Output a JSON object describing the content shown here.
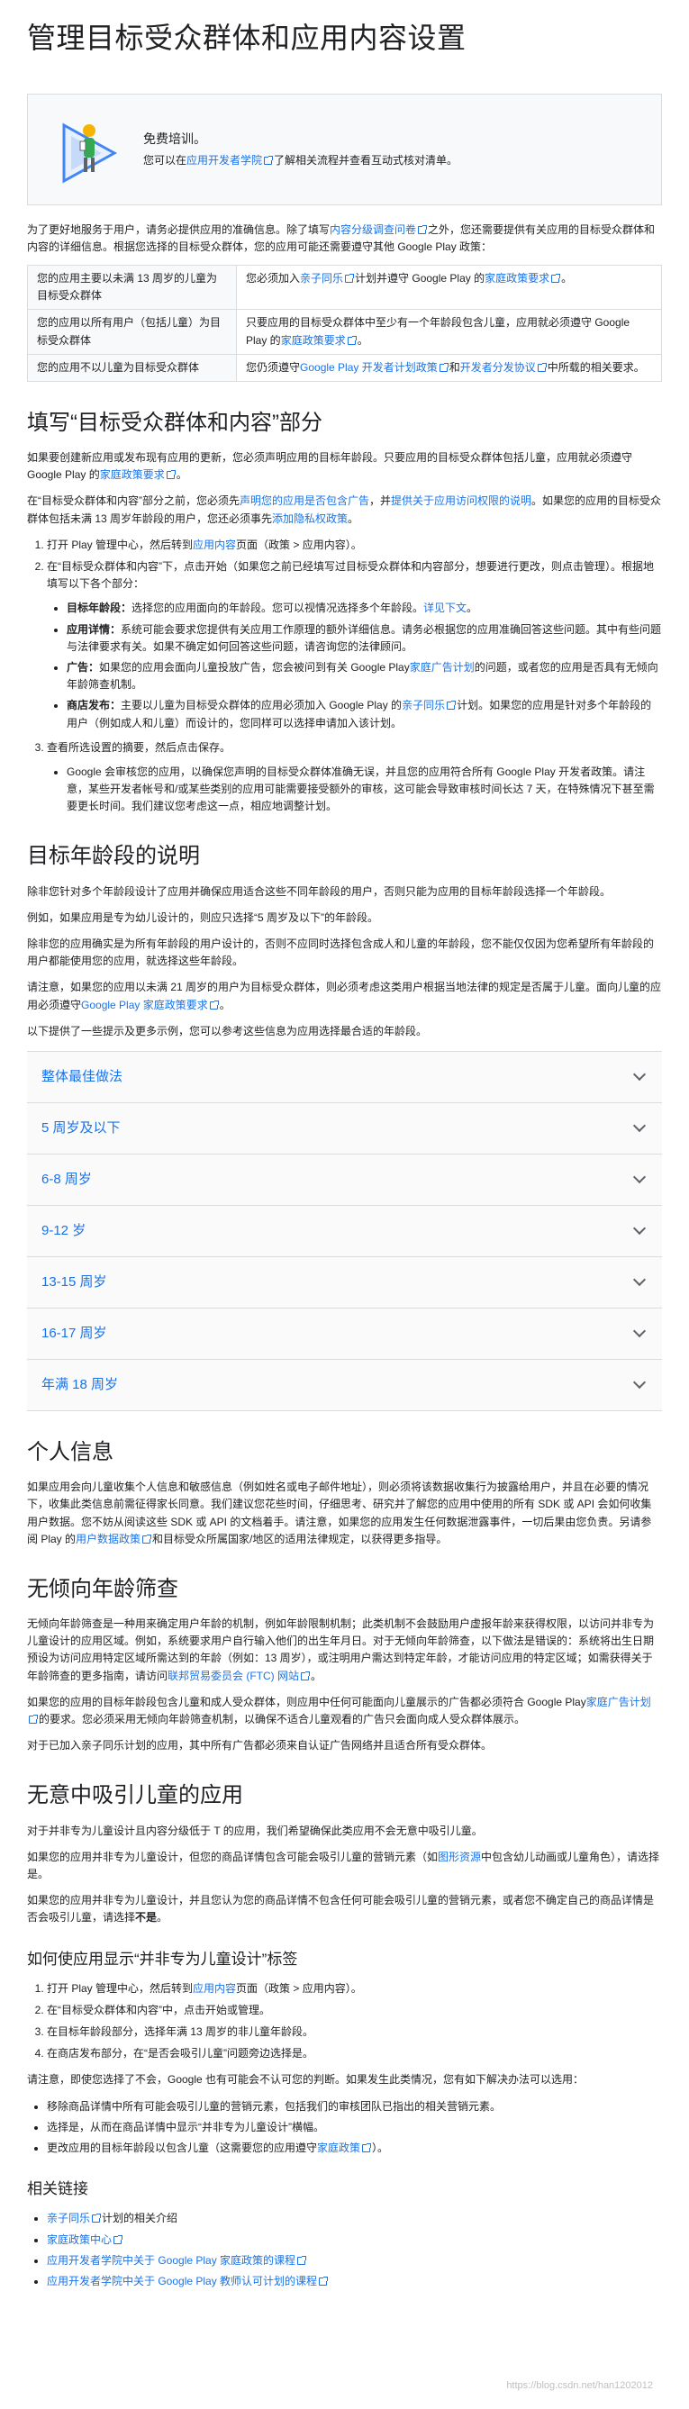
{
  "title": "管理目标受众群体和应用内容设置",
  "training": {
    "title": "免费培训。",
    "text_before": "您可以在",
    "link": "应用开发者学院",
    "text_after": "了解相关流程并查看互动式核对清单。"
  },
  "intro": {
    "text1": "为了更好地服务于用户，请务必提供应用的准确信息。除了填写",
    "link1": "内容分级调查问卷",
    "text2": "之外，您还需要提供有关应用的目标受众群体和内容的详细信息。根据您选择的目标受众群体，您的应用可能还需要遵守其他 Google Play 政策："
  },
  "table": [
    {
      "c1": "您的应用主要以未满 13 周岁的儿童为目标受众群体",
      "c2a": "您必须加入",
      "c2link": "亲子同乐",
      "c2b": "计划并遵守 Google Play 的",
      "c2link2": "家庭政策要求",
      "c2c": "。"
    },
    {
      "c1": "您的应用以所有用户（包括儿童）为目标受众群体",
      "c2a": "只要应用的目标受众群体中至少有一个年龄段包含儿童，应用就必须遵守 Google Play 的",
      "c2link": "家庭政策要求",
      "c2b": "。",
      "c2link2": "",
      "c2c": ""
    },
    {
      "c1": "您的应用不以儿童为目标受众群体",
      "c2a": "您仍须遵守",
      "c2link": "Google Play 开发者计划政策",
      "c2b": "和",
      "c2link2": "开发者分发协议",
      "c2c": "中所载的相关要求。"
    }
  ],
  "section1": {
    "heading": "填写“目标受众群体和内容”部分",
    "p1a": "如果要创建新应用或发布现有应用的更新，您必须声明应用的目标年龄段。只要应用的目标受众群体包括儿童，应用就必须遵守 Google Play 的",
    "p1link": "家庭政策要求",
    "p1b": "。",
    "p2a": "在“目标受众群体和内容”部分之前，您必须先",
    "p2link1": "声明您的应用是否包含广告",
    "p2b": "，并",
    "p2link2": "提供关于应用访问权限的说明",
    "p2c": "。如果您的应用的目标受众群体包括未满 13 周岁年龄段的用户，您还必须事先",
    "p2link3": "添加隐私权政策",
    "p2d": "。",
    "steps": [
      {
        "a": "打开 Play 管理中心，然后转到",
        "link": "应用内容",
        "b": "页面（政策 > 应用内容）。"
      },
      {
        "a": "在“目标受众群体和内容”下，点击开始（如果您之前已经填写过目标受众群体和内容部分，想要进行更改，则点击管理）。根据地填写以下各个部分：",
        "link": "",
        "b": ""
      },
      {
        "a": "查看所选设置的摘要，然后点击保存。",
        "link": "",
        "b": ""
      }
    ],
    "sub_items": [
      {
        "label": "目标年龄段：",
        "a": "选择您的应用面向的年龄段。您可以视情况选择多个年龄段。",
        "link": "详见下文",
        "b": "。"
      },
      {
        "label": "应用详情：",
        "a": "系统可能会要求您提供有关应用工作原理的额外详细信息。请务必根据您的应用准确回答这些问题。其中有些问题与法律要求有关。如果不确定如何回答这些问题，请咨询您的法律顾问。",
        "link": "",
        "b": ""
      },
      {
        "label": "广告：",
        "a": "如果您的应用会面向儿童投放广告，您会被问到有关 Google Play",
        "link": "家庭广告计划",
        "b": "的问题，或者您的应用是否具有无倾向年龄筛查机制。"
      },
      {
        "label": "商店发布：",
        "a": "主要以儿童为目标受众群体的应用必须加入 Google Play 的",
        "link": "亲子同乐",
        "b": "计划。如果您的应用是针对多个年龄段的用户（例如成人和儿童）而设计的，您同样可以选择申请加入该计划。"
      }
    ],
    "step3_note": "Google 会审核您的应用，以确保您声明的目标受众群体准确无误，并且您的应用符合所有 Google Play 开发者政策。请注意，某些开发者帐号和/或某些类别的应用可能需要接受额外的审核，这可能会导致审核时间长达 7 天，在特殊情况下甚至需要更长时间。我们建议您考虑这一点，相应地调整计划。"
  },
  "section2": {
    "heading": "目标年龄段的说明",
    "p1": "除非您针对多个年龄段设计了应用并确保应用适合这些不同年龄段的用户，否则只能为应用的目标年龄段选择一个年龄段。",
    "p2": "例如，如果应用是专为幼儿设计的，则应只选择“5 周岁及以下”的年龄段。",
    "p3": "除非您的应用确实是为所有年龄段的用户设计的，否则不应同时选择包含成人和儿童的年龄段，您不能仅仅因为您希望所有年龄段的用户都能使用您的应用，就选择这些年龄段。",
    "p4a": "请注意，如果您的应用以未满 21 周岁的用户为目标受众群体，则必须考虑这类用户根据当地法律的规定是否属于儿童。面向儿童的应用必须遵守",
    "p4link": "Google Play 家庭政策要求",
    "p4b": "。",
    "p5": "以下提供了一些提示及更多示例，您可以参考这些信息为应用选择最合适的年龄段。",
    "accordion": [
      "整体最佳做法",
      "5 周岁及以下",
      "6-8 周岁",
      "9-12 岁",
      "13-15 周岁",
      "16-17 周岁",
      "年满 18 周岁"
    ]
  },
  "section3": {
    "heading": "个人信息",
    "p1a": "如果应用会向儿童收集个人信息和敏感信息（例如姓名或电子邮件地址），则必须将该数据收集行为披露给用户，并且在必要的情况下，收集此类信息前需征得家长同意。我们建议您花些时间，仔细思考、研究并了解您的应用中使用的所有 SDK 或 API 会如何收集用户数据。您不妨从阅读这些 SDK 或 API 的文档着手。请注意，如果您的应用发生任何数据泄露事件，一切后果由您负责。另请参阅 Play 的",
    "p1link": "用户数据政策",
    "p1b": "和目标受众所属国家/地区的适用法律规定，以获得更多指导。"
  },
  "section4": {
    "heading": "无倾向年龄筛查",
    "p1a": "无倾向年龄筛查是一种用来确定用户年龄的机制，例如年龄限制机制；此类机制不会鼓励用户虚报年龄来获得权限，以访问并非专为儿童设计的应用区域。例如，系统要求用户自行输入他们的出生年月日。对于无倾向年龄筛查，以下做法是错误的：系统将出生日期预设为访问应用特定区域所需达到的年龄（例如：13 周岁），或注明用户需达到特定年龄，才能访问应用的特定区域；如需获得关于年龄筛查的更多指南，请访问",
    "p1link": "联邦贸易委员会 (FTC) 网站",
    "p1b": "。",
    "p2a": "如果您的应用的目标年龄段包含儿童和成人受众群体，则应用中任何可能面向儿童展示的广告都必须符合 Google Play",
    "p2link": "家庭广告计划",
    "p2b": "的要求。您必须采用无倾向年龄筛查机制，以确保不适合儿童观看的广告只会面向成人受众群体展示。",
    "p3": "对于已加入亲子同乐计划的应用，其中所有广告都必须来自认证广告网络并且适合所有受众群体。"
  },
  "section5": {
    "heading": "无意中吸引儿童的应用",
    "p1": "对于并非专为儿童设计且内容分级低于 T 的应用，我们希望确保此类应用不会无意中吸引儿童。",
    "p2a": "如果您的应用并非专为儿童设计，但您的商品详情包含可能会吸引儿童的营销元素（如",
    "p2link": "图形资源",
    "p2b": "中包含幼儿动画或儿童角色），请选择是。",
    "p3a": "如果您的应用并非专为儿童设计，并且您认为您的商品详情不包含任何可能会吸引儿童的营销元素，或者您不确定自己的商品详情是否会吸引儿童，请选择",
    "p3b": "不是",
    "p3c": "。"
  },
  "section6": {
    "heading": "如何使应用显示“并非专为儿童设计”标签",
    "steps": [
      {
        "a": "打开 Play 管理中心，然后转到",
        "link": "应用内容",
        "b": "页面（政策 > 应用内容）。"
      },
      {
        "a": "在“目标受众群体和内容”中，点击开始或管理。",
        "link": "",
        "b": ""
      },
      {
        "a": "在目标年龄段部分，选择年满 13 周岁的非儿童年龄段。",
        "link": "",
        "b": ""
      },
      {
        "a": "在商店发布部分，在“是否会吸引儿童”问题旁边选择是。",
        "link": "",
        "b": ""
      }
    ],
    "p1": "请注意，即使您选择了不会，Google 也有可能会不认可您的判断。如果发生此类情况，您有如下解决办法可以选用：",
    "bullets": [
      {
        "a": "移除商品详情中所有可能会吸引儿童的营销元素，包括我们的审核团队已指出的相关营销元素。",
        "link": "",
        "b": ""
      },
      {
        "a": "选择是，从而在商品详情中显示“并非专为儿童设计”横幅。",
        "link": "",
        "b": ""
      },
      {
        "a": "更改应用的目标年龄段以包含儿童（这需要您的应用遵守",
        "link": "家庭政策",
        "b": "）。"
      }
    ]
  },
  "related": {
    "heading": "相关链接",
    "links": [
      {
        "link": "亲子同乐",
        "b": "计划的相关介绍"
      },
      {
        "link": "家庭政策中心",
        "b": ""
      },
      {
        "link": "应用开发者学院中关于 Google Play 家庭政策的课程",
        "b": ""
      },
      {
        "link": "应用开发者学院中关于 Google Play 教师认可计划的课程",
        "b": ""
      }
    ]
  },
  "watermark": "https://blog.csdn.net/han1202012"
}
